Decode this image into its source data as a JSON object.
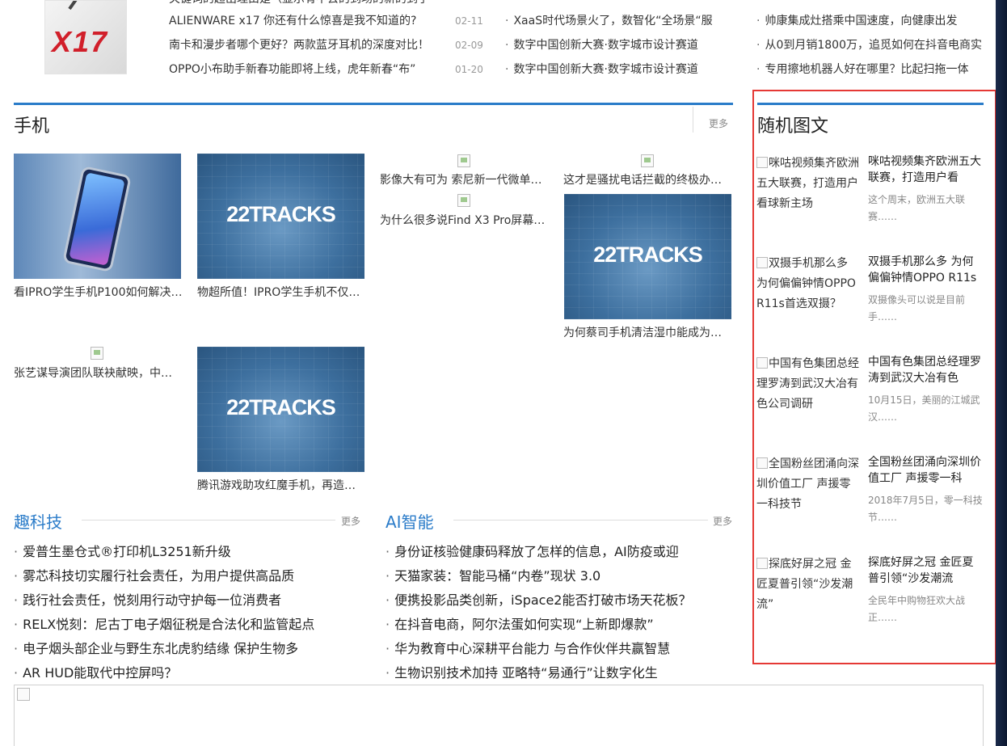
{
  "top": {
    "partial_row": "关键词的超出理由是（显示有不去的到场的新的到了",
    "left_rows": [
      {
        "title": "ALIENWARE x17 你还有什么惊喜是我不知道的?",
        "date": "02-11"
      },
      {
        "title": "南卡和漫步者哪个更好？两款蓝牙耳机的深度对比！",
        "date": "02-09"
      },
      {
        "title": "OPPO小布助手新春功能即将上线，虎年新春“布”",
        "date": "01-20"
      }
    ],
    "mid_rows": [
      "XaaS时代场景火了，数智化“全场景“服",
      "数字中国创新大赛·数字城市设计赛道",
      "数字中国创新大赛·数字城市设计赛道"
    ],
    "right_rows": [
      "帅康集成灶搭乘中国速度，向健康出发",
      "从0到月销1800万，追觅如何在抖音电商实",
      "专用擦地机器人好在哪里？比起扫拖一体"
    ]
  },
  "phone_section": {
    "title": "手机",
    "more": "更多",
    "items": [
      {
        "caption": "看IPRO学生手机P100如何解决…"
      },
      {
        "caption": "物超所值！IPRO学生手机不仅…",
        "thumb_text": "22TRACKS"
      },
      {
        "caption": "影像大有可为 索尼新一代微单…"
      },
      {
        "caption": "这才是骚扰电话拦截的终极办…"
      },
      {
        "caption": "为什么很多说Find X3 Pro屏幕…"
      },
      {
        "caption": "为何蔡司手机清洁湿巾能成为…",
        "thumb_text": "22TRACKS"
      },
      {
        "caption": "张艺谋导演团队联袂献映，中…"
      },
      {
        "caption": "腾讯游戏助攻红魔手机，再造…",
        "thumb_text": "22TRACKS"
      }
    ]
  },
  "tech_section": {
    "title": "趣科技",
    "more": "更多",
    "items": [
      "爱普生墨仓式®打印机L3251新升级",
      "雾芯科技切实履行社会责任，为用户提供高品质",
      "践行社会责任，悦刻用行动守护每一位消费者",
      "RELX悦刻：尼古丁电子烟征税是合法化和监管起点",
      "电子烟头部企业与野生东北虎豹结缘 保护生物多",
      "AR HUD能取代中控屏吗？"
    ]
  },
  "ai_section": {
    "title": "AI智能",
    "more": "更多",
    "items": [
      "身份证核验健康码释放了怎样的信息，AI防疫或迎",
      "天猫家装：智能马桶“内卷”现状 3.0",
      "便携投影品类创新，iSpace2能否打破市场天花板？",
      "在抖音电商，阿尔法蛋如何实现“上新即爆款”",
      "华为教育中心深耕平台能力 与合作伙伴共赢智慧",
      "生物识别技术加持 亚略特“易通行”让数字化生"
    ]
  },
  "random": {
    "title": "随机图文",
    "items": [
      {
        "alt": "咪咕视频集齐欧洲五大联赛，打造用户看球新主场",
        "title": "咪咕视频集齐欧洲五大联赛，打造用户看",
        "desc": "这个周末，欧洲五大联赛……"
      },
      {
        "alt": "双摄手机那么多 为何偏偏钟情OPPO R11s首选双摄？",
        "title": "双摄手机那么多 为何偏偏钟情OPPO R11s",
        "desc": "双摄像头可以说是目前手……"
      },
      {
        "alt": "中国有色集团总经理罗涛到武汉大冶有色公司调研",
        "title": "中国有色集团总经理罗涛到武汉大冶有色",
        "desc": "10月15日，美丽的江城武汉……"
      },
      {
        "alt": "全国粉丝团涌向深圳价值工厂 声援零一科技节",
        "title": "全国粉丝团涌向深圳价值工厂 声援零一科",
        "desc": "2018年7月5日，零一科技节……"
      },
      {
        "alt": "探底好屏之冠 金匠夏普引领“沙发潮流”",
        "title": "探底好屏之冠 金匠夏普引领“沙发潮流",
        "desc": "全民年中购物狂欢大战正……"
      }
    ]
  },
  "colors": {
    "accent": "#2b7cc9",
    "highlight_frame": "#e53935",
    "link_blue": "#2b7cc9"
  }
}
